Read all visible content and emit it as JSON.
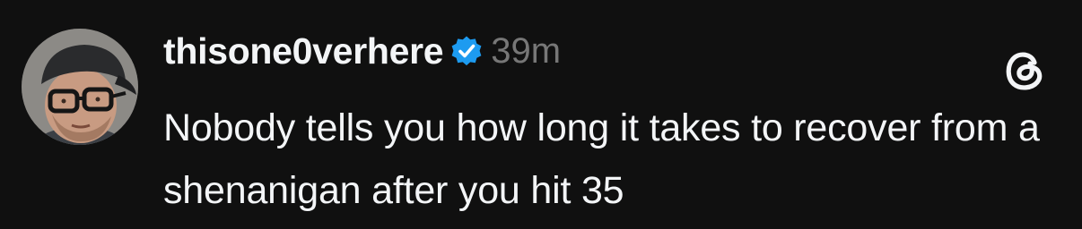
{
  "post": {
    "username": "thisone0verhere",
    "verified_icon": "verified-badge-icon",
    "timestamp": "39m",
    "text": "Nobody tells you how long it takes to recover from a shenanigan after you hit 35",
    "app_logo_icon": "threads-logo-icon"
  },
  "colors": {
    "background": "#101010",
    "primary_text": "#f3f5f7",
    "secondary_text": "#777777",
    "verified": "#1d9bf0"
  }
}
